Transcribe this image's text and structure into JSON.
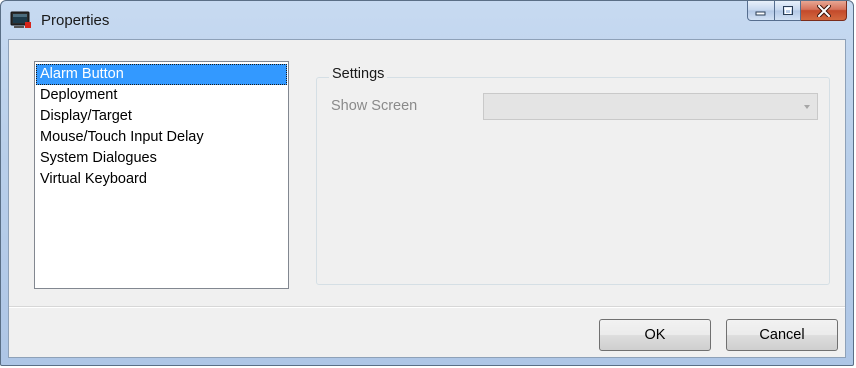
{
  "window": {
    "title": "Properties",
    "app_icon": "monitor-icon"
  },
  "caption_buttons": {
    "minimize": "minimize-icon",
    "maximize": "maximize-icon",
    "close": "close-icon"
  },
  "nav": {
    "items": [
      {
        "label": "Alarm Button",
        "selected": true
      },
      {
        "label": "Deployment",
        "selected": false
      },
      {
        "label": "Display/Target",
        "selected": false
      },
      {
        "label": "Mouse/Touch Input Delay",
        "selected": false
      },
      {
        "label": "System Dialogues",
        "selected": false
      },
      {
        "label": "Virtual Keyboard",
        "selected": false
      }
    ]
  },
  "settings": {
    "group_label": "Settings",
    "show_screen_label": "Show Screen",
    "show_screen_value": "",
    "enabled": false
  },
  "footer": {
    "ok_label": "OK",
    "cancel_label": "Cancel"
  },
  "colors": {
    "selection": "#3399ff",
    "frame": "#b9cfea",
    "close_button": "#c34a2b"
  }
}
